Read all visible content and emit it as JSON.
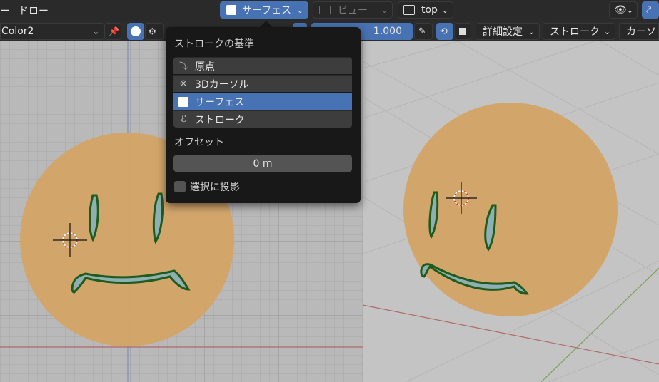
{
  "header": {
    "menu_fragment": "ー",
    "draw_menu": "ドロー",
    "stroke_placement": "サーフェス",
    "view_dropdown": "ビュー",
    "view_orientation": "top",
    "icons": [
      "eye-visibility-icon",
      "curve-icon"
    ]
  },
  "toolbar": {
    "material": "Color2",
    "strength_value": "1.000",
    "advanced": "詳細設定",
    "stroke": "ストローク",
    "cursor": "カーソ"
  },
  "popup": {
    "title": "ストロークの基準",
    "options": [
      {
        "label": "原点",
        "icon": "origin-icon",
        "selected": false
      },
      {
        "label": "3Dカーソル",
        "icon": "3d-cursor-icon",
        "selected": false
      },
      {
        "label": "サーフェス",
        "icon": "surface-icon",
        "selected": true
      },
      {
        "label": "ストローク",
        "icon": "stroke-icon",
        "selected": false
      }
    ],
    "offset_label": "オフセット",
    "offset_value": "0 m",
    "project_label": "選択に投影"
  },
  "colors": {
    "accent": "#4772b3",
    "face_fill": "#d3a468",
    "stroke_green": "#1f5b1a",
    "inner_blue": "#8eb0b5"
  }
}
